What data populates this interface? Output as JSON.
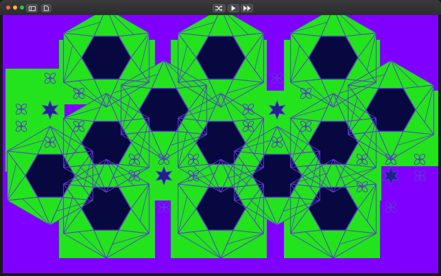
{
  "window": {
    "traffic_lights": [
      "#fe5f57",
      "#febc2e",
      "#28c840"
    ],
    "toolbar": [
      {
        "name": "sidebar-toggle-button",
        "icon": "sidebar-icon"
      },
      {
        "name": "new-document-button",
        "icon": "document-icon"
      },
      {
        "name": "shuffle-button",
        "icon": "shuffle-icon"
      },
      {
        "name": "play-button",
        "icon": "play-icon"
      },
      {
        "name": "fast-forward-button",
        "icon": "fast-forward-icon"
      }
    ]
  },
  "pattern": {
    "background": "#8000ff",
    "tile_fill": "#22e31c",
    "hexagon_fill": "#080840",
    "line_color": "#5a3ad0",
    "star_fill": "#202090",
    "motifs": [
      "hexagon-tile",
      "flower-cluster",
      "star-rosette"
    ]
  }
}
